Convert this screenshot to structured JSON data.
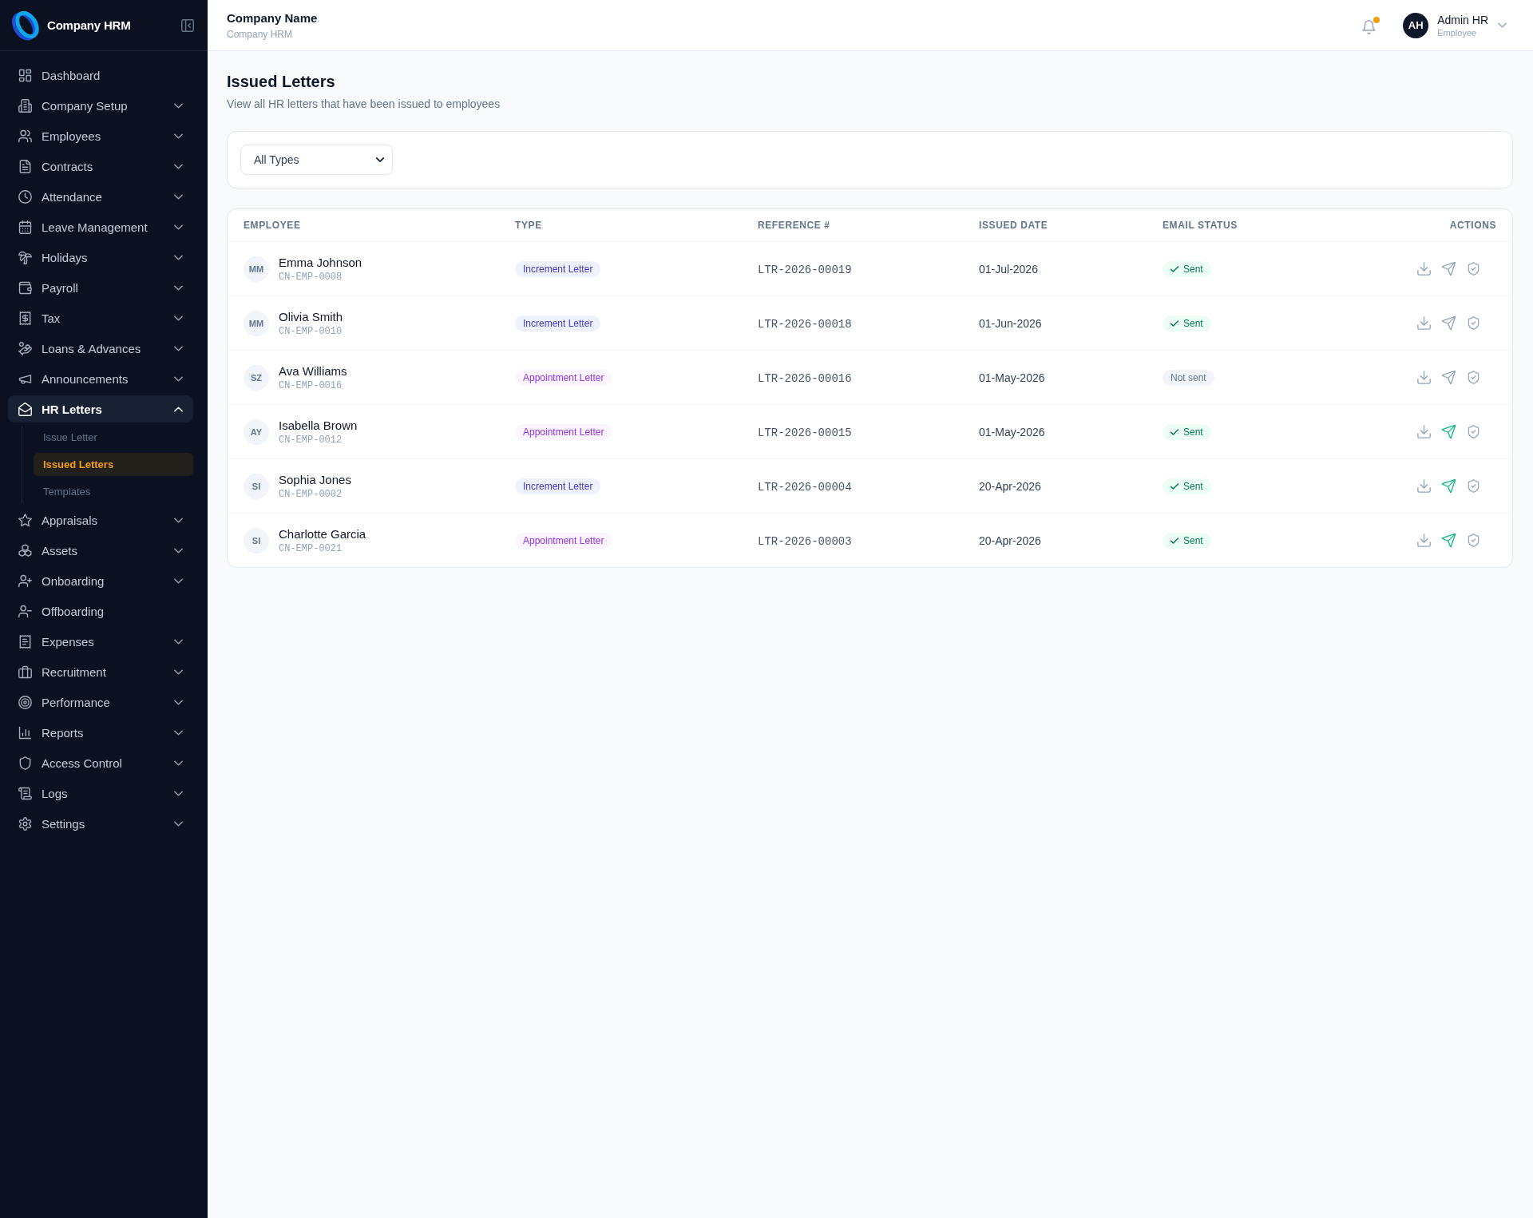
{
  "sidebar": {
    "brand": "Company HRM",
    "items": [
      {
        "label": "Dashboard",
        "selected": false
      },
      {
        "label": "Company Setup",
        "selected": false,
        "expanded": false
      },
      {
        "label": "Employees",
        "selected": false,
        "expanded": false
      },
      {
        "label": "Contracts",
        "selected": false,
        "expanded": false
      },
      {
        "label": "Attendance",
        "selected": false,
        "expanded": false
      },
      {
        "label": "Leave Management",
        "selected": false,
        "expanded": false
      },
      {
        "label": "Holidays",
        "selected": false,
        "expanded": false
      },
      {
        "label": "Payroll",
        "selected": false,
        "expanded": false
      },
      {
        "label": "Tax",
        "selected": false,
        "expanded": false
      },
      {
        "label": "Loans & Advances",
        "selected": false,
        "expanded": false
      },
      {
        "label": "Announcements",
        "selected": false,
        "expanded": false
      },
      {
        "label": "HR Letters",
        "selected": true,
        "expanded": true,
        "children": [
          {
            "label": "Issue Letter",
            "selected": false
          },
          {
            "label": "Issued Letters",
            "selected": true
          },
          {
            "label": "Templates",
            "selected": false
          }
        ]
      },
      {
        "label": "Appraisals",
        "selected": false,
        "expanded": false
      },
      {
        "label": "Assets",
        "selected": false,
        "expanded": false
      },
      {
        "label": "Onboarding",
        "selected": false,
        "expanded": false
      },
      {
        "label": "Offboarding",
        "selected": false
      },
      {
        "label": "Expenses",
        "selected": false,
        "expanded": false
      },
      {
        "label": "Recruitment",
        "selected": false,
        "expanded": false
      },
      {
        "label": "Performance",
        "selected": false,
        "expanded": false
      },
      {
        "label": "Reports",
        "selected": false,
        "expanded": false
      },
      {
        "label": "Access Control",
        "selected": false,
        "expanded": false
      },
      {
        "label": "Logs",
        "selected": false,
        "expanded": false
      },
      {
        "label": "Settings",
        "selected": false,
        "expanded": false
      }
    ]
  },
  "header": {
    "company_name": "Company Name",
    "company_subtitle": "Company HRM",
    "notifications": {
      "unread": true
    },
    "user": {
      "initials": "AH",
      "name": "Admin HR",
      "role": "Employee"
    }
  },
  "page": {
    "title": "Issued Letters",
    "subtitle": "View all HR letters that have been issued to employees"
  },
  "filter": {
    "value": "All Types"
  },
  "table": {
    "columns": [
      "EMPLOYEE",
      "TYPE",
      "REFERENCE #",
      "ISSUED DATE",
      "EMAIL STATUS",
      "ACTIONS"
    ],
    "rows": [
      {
        "initials": "MM",
        "name": "Emma Johnson",
        "code": "CN-EMP-0008",
        "type": {
          "label": "Increment Letter",
          "kind": "increment"
        },
        "reference": "LTR-2026-00019",
        "issued_date": "01-Jul-2026",
        "email_status": {
          "label": "Sent",
          "sent": true
        },
        "send_highlighted": false
      },
      {
        "initials": "MM",
        "name": "Olivia Smith",
        "code": "CN-EMP-0010",
        "type": {
          "label": "Increment Letter",
          "kind": "increment"
        },
        "reference": "LTR-2026-00018",
        "issued_date": "01-Jun-2026",
        "email_status": {
          "label": "Sent",
          "sent": true
        },
        "send_highlighted": false
      },
      {
        "initials": "SZ",
        "name": "Ava Williams",
        "code": "CN-EMP-0016",
        "type": {
          "label": "Appointment Letter",
          "kind": "appointment"
        },
        "reference": "LTR-2026-00016",
        "issued_date": "01-May-2026",
        "email_status": {
          "label": "Not sent",
          "sent": false
        },
        "send_highlighted": false
      },
      {
        "initials": "AY",
        "name": "Isabella Brown",
        "code": "CN-EMP-0012",
        "type": {
          "label": "Appointment Letter",
          "kind": "appointment"
        },
        "reference": "LTR-2026-00015",
        "issued_date": "01-May-2026",
        "email_status": {
          "label": "Sent",
          "sent": true
        },
        "send_highlighted": true
      },
      {
        "initials": "SI",
        "name": "Sophia Jones",
        "code": "CN-EMP-0002",
        "type": {
          "label": "Increment Letter",
          "kind": "increment"
        },
        "reference": "LTR-2026-00004",
        "issued_date": "20-Apr-2026",
        "email_status": {
          "label": "Sent",
          "sent": true
        },
        "send_highlighted": true
      },
      {
        "initials": "SI",
        "name": "Charlotte Garcia",
        "code": "CN-EMP-0021",
        "type": {
          "label": "Appointment Letter",
          "kind": "appointment"
        },
        "reference": "LTR-2026-00003",
        "issued_date": "20-Apr-2026",
        "email_status": {
          "label": "Sent",
          "sent": true
        },
        "send_highlighted": true
      }
    ]
  }
}
